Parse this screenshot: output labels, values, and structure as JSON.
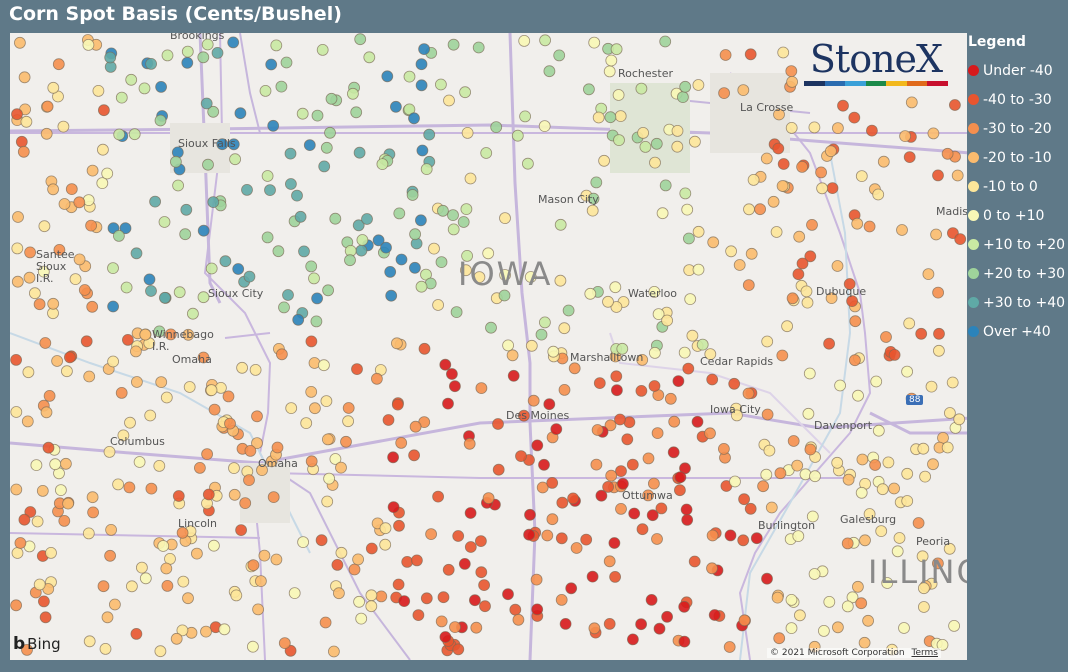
{
  "title": "Corn Spot Basis (Cents/Bushel)",
  "legend": {
    "title": "Legend",
    "items": [
      {
        "label": "Under -40",
        "color": "#d7191c"
      },
      {
        "label": "-40 to -30",
        "color": "#e8552f"
      },
      {
        "label": "-30 to -20",
        "color": "#f58f4e"
      },
      {
        "label": "-20 to -10",
        "color": "#fbbb6e"
      },
      {
        "label": "-10 to 0",
        "color": "#fde69a"
      },
      {
        "label": "0 to +10",
        "color": "#f8f7b6"
      },
      {
        "label": "+10 to +20",
        "color": "#c9e9a3"
      },
      {
        "label": "+20 to +30",
        "color": "#9fd39b"
      },
      {
        "label": "+30 to +40",
        "color": "#5fa9a6"
      },
      {
        "label": "Over +40",
        "color": "#2b83ba"
      }
    ]
  },
  "logo": {
    "text": "StoneX",
    "bar_colors": [
      "#1d3461",
      "#2b6cb0",
      "#3aa0d8",
      "#1c8a4a",
      "#f2b81c",
      "#e06a1b",
      "#c8102e"
    ]
  },
  "attribution": {
    "bing": "Bing",
    "copyright": "© 2021 Microsoft Corporation",
    "terms": "Terms"
  },
  "map": {
    "state_labels": [
      "IOWA",
      "ILLINO"
    ],
    "cities": [
      "Brookings",
      "Rochester",
      "La Crosse",
      "Sioux Falls",
      "Mason City",
      "Santee Sioux I.R.",
      "Sioux City",
      "Waterloo",
      "Dubuque",
      "Winnebago I.R.",
      "Omaha",
      "Marshalltown",
      "Cedar Rapids",
      "Des Moines",
      "Iowa City",
      "Davenport",
      "Columbus",
      "Omaha",
      "Ottumwa",
      "Lincoln",
      "Burlington",
      "Galesburg",
      "Peoria",
      "Madison"
    ],
    "interstate_shield": "88"
  }
}
